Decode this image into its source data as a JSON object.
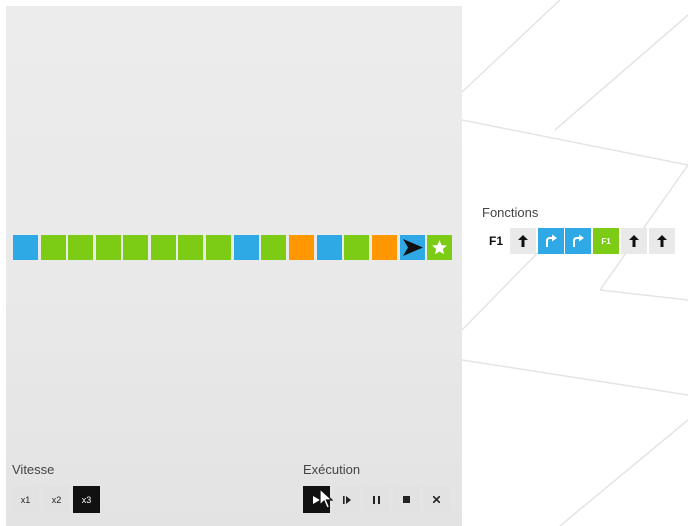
{
  "board": {
    "tiles": [
      "blue",
      "green",
      "green",
      "green",
      "green",
      "green",
      "green",
      "green",
      "blue",
      "green",
      "orange",
      "blue",
      "green",
      "orange",
      "blue-robot",
      "green-goal"
    ]
  },
  "speed": {
    "label": "Vitesse",
    "options": [
      "x1",
      "x2",
      "x3"
    ],
    "selected": "x3"
  },
  "execution": {
    "label": "Exécution",
    "buttons": [
      "play-icon",
      "step-icon",
      "pause-icon",
      "stop-icon",
      "close-icon"
    ]
  },
  "functions": {
    "title": "Fonctions",
    "f1": {
      "label": "F1",
      "slots": [
        {
          "icon": "arrow-up-icon",
          "color": "grey"
        },
        {
          "icon": "turn-right-icon",
          "color": "blue"
        },
        {
          "icon": "turn-right-icon",
          "color": "blue"
        },
        {
          "icon": "call-f1",
          "color": "green",
          "text": "F1"
        },
        {
          "icon": "arrow-up-icon",
          "color": "grey"
        },
        {
          "icon": "arrow-up-icon",
          "color": "grey"
        }
      ]
    }
  },
  "colors": {
    "blue": "#2fa9e6",
    "green": "#7ccc16",
    "orange": "#ff9800",
    "active": "#111111"
  }
}
